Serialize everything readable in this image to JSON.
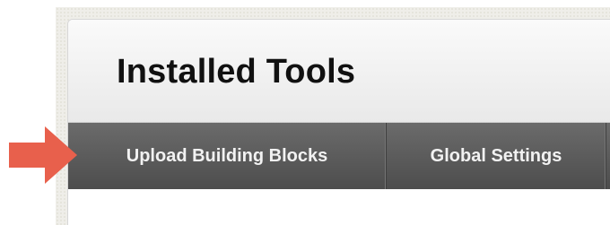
{
  "page": {
    "title": "Installed Tools"
  },
  "tabs": [
    {
      "label": "Upload Building Blocks"
    },
    {
      "label": "Global Settings"
    }
  ],
  "colors": {
    "arrow": "#e8604c",
    "tabbar": "#5a5a5a",
    "tab_text": "#f2f2f2"
  },
  "icons": {
    "pointer": "arrow-right-icon"
  }
}
